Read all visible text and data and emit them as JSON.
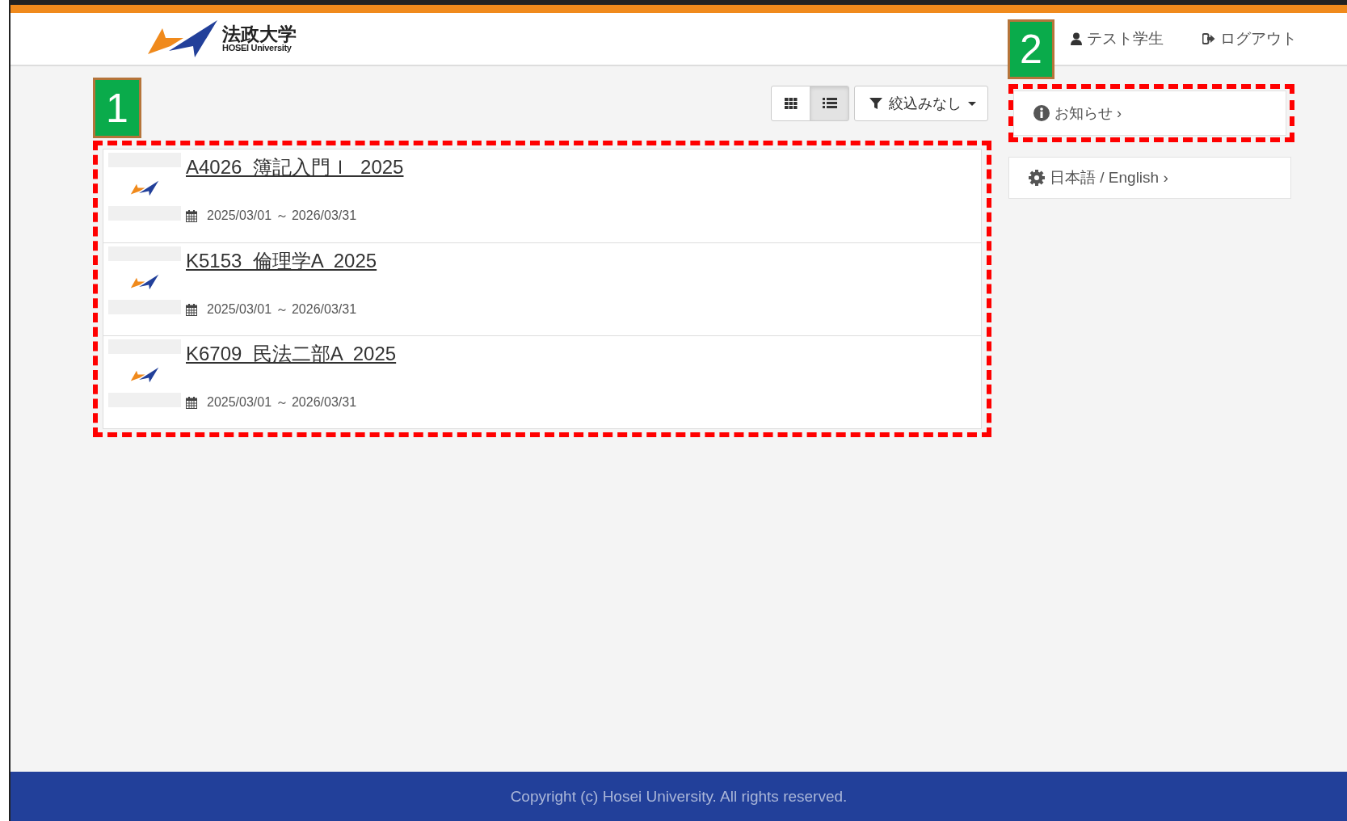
{
  "header": {
    "logo_name": "法政大学",
    "logo_sub": "HOSEI University",
    "user": "テスト学生",
    "logout": "ログアウト"
  },
  "annotations": [
    {
      "label": "1"
    },
    {
      "label": "2"
    }
  ],
  "view_toggle": [
    {
      "kind": "grid",
      "selected": false
    },
    {
      "kind": "list",
      "selected": true
    }
  ],
  "filter": {
    "label": "絞込みなし"
  },
  "courses": [
    {
      "title": "A4026  簿記入門Ｉ  2025",
      "period": "2025/03/01 ～ 2026/03/31"
    },
    {
      "title": "K5153  倫理学A  2025",
      "period": "2025/03/01 ～ 2026/03/31"
    },
    {
      "title": "K6709  民法二部A  2025",
      "period": "2025/03/01 ～ 2026/03/31"
    }
  ],
  "side_links": [
    {
      "kind": "info",
      "label": "お知らせ ›"
    },
    {
      "kind": "settings",
      "label": "日本語 / English ›"
    }
  ],
  "footer": "Copyright (c) Hosei University. All rights reserved."
}
